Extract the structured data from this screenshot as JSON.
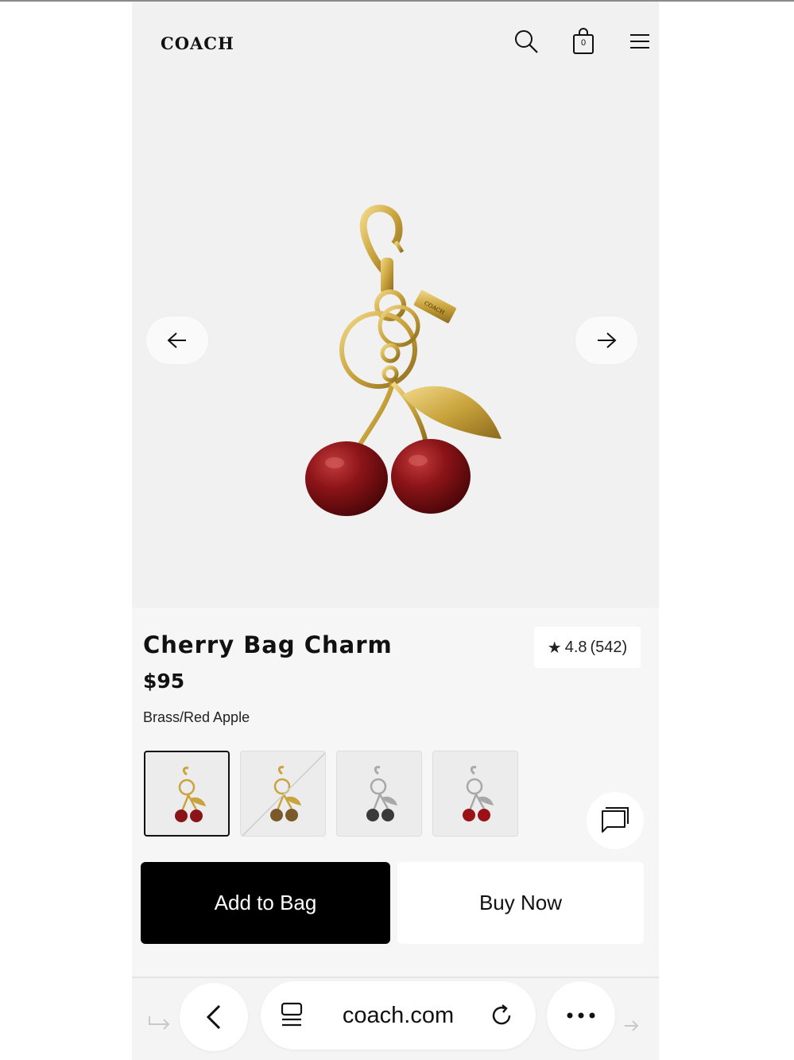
{
  "brand": {
    "logo_text": "COACH"
  },
  "header": {
    "bag_count": "0"
  },
  "product": {
    "title": "Cherry Bag Charm",
    "price": "$95",
    "color": "Brass/Red Apple",
    "rating": "4.8",
    "review_count": "(542)",
    "rating_star": "★"
  },
  "swatches": [
    {
      "name": "Brass/Red Apple",
      "cherry_color": "#8b1418",
      "metal_color": "#c9a33c"
    },
    {
      "name": "Brass/Bronze",
      "cherry_color": "#7a5a2a",
      "metal_color": "#c9a33c"
    },
    {
      "name": "Silver/Black",
      "cherry_color": "#3a3a3a",
      "metal_color": "#a8a8a8"
    },
    {
      "name": "Silver/Red",
      "cherry_color": "#9a1218",
      "metal_color": "#a8a8a8"
    }
  ],
  "actions": {
    "add_to_bag": "Add to Bag",
    "buy_now": "Buy Now"
  },
  "browser": {
    "url": "coach.com"
  },
  "colors": {
    "accent": "#000000",
    "cherry": "#8b1418",
    "brass": "#c9a33c",
    "page_bg": "#f1f1f1"
  },
  "icons": [
    "search-icon",
    "shopping-bag-icon",
    "menu-icon",
    "arrow-left-icon",
    "arrow-right-icon",
    "chat-icon",
    "back-chevron-icon",
    "tabs-icon",
    "reload-icon",
    "more-icon",
    "share-arrow-icon"
  ]
}
